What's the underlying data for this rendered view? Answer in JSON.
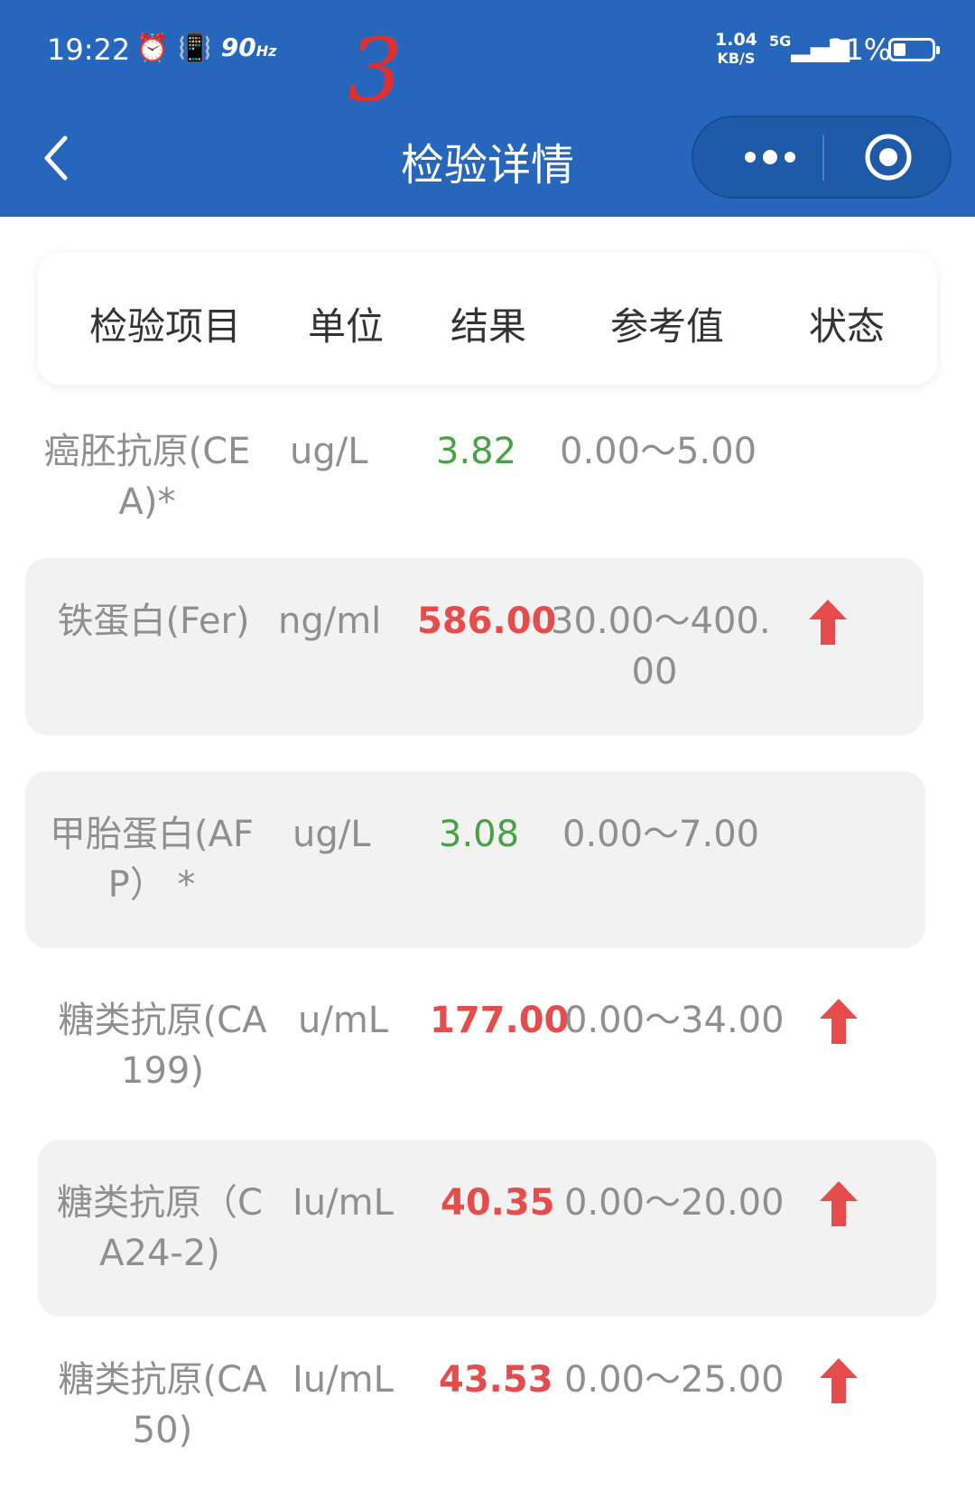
{
  "status_bar": {
    "time": "19:22",
    "hz_value": "90",
    "hz_unit": "Hz",
    "net_speed_value": "1.04",
    "net_speed_unit": "KB/S",
    "network": "5G",
    "battery_percent": "31%",
    "battery_level": 0.31
  },
  "annotation": "3",
  "nav": {
    "title": "检验详情"
  },
  "table": {
    "headers": [
      "检验项目",
      "单位",
      "结果",
      "参考值",
      "状态"
    ],
    "rows": [
      {
        "name_line1": "癌胚抗原(CE",
        "name_line2": "A)*",
        "unit": "ug/L",
        "result": "3.82",
        "reference_line1": "0.00～5.00",
        "reference_line2": "",
        "status": "normal"
      },
      {
        "name_line1": "铁蛋白(Fer)",
        "name_line2": "",
        "unit": "ng/ml",
        "result": "586.00",
        "reference_line1": "30.00～400.",
        "reference_line2": "00",
        "status": "high"
      },
      {
        "name_line1": "甲胎蛋白(AF",
        "name_line2": "P） *",
        "unit": "ug/L",
        "result": "3.08",
        "reference_line1": "0.00～7.00",
        "reference_line2": "",
        "status": "normal"
      },
      {
        "name_line1": "糖类抗原(CA",
        "name_line2": "199)",
        "unit": "u/mL",
        "result": "177.00",
        "reference_line1": "0.00～34.00",
        "reference_line2": "",
        "status": "high"
      },
      {
        "name_line1": "糖类抗原（C",
        "name_line2": "A24-2)",
        "unit": "Iu/mL",
        "result": "40.35",
        "reference_line1": "0.00～20.00",
        "reference_line2": "",
        "status": "high"
      },
      {
        "name_line1": "糖类抗原(CA",
        "name_line2": "50)",
        "unit": "Iu/mL",
        "result": "43.53",
        "reference_line1": "0.00～25.00",
        "reference_line2": "",
        "status": "high"
      }
    ]
  },
  "colors": {
    "header_bg": "#2667bd",
    "normal": "#49a146",
    "high": "#e74c4c"
  }
}
